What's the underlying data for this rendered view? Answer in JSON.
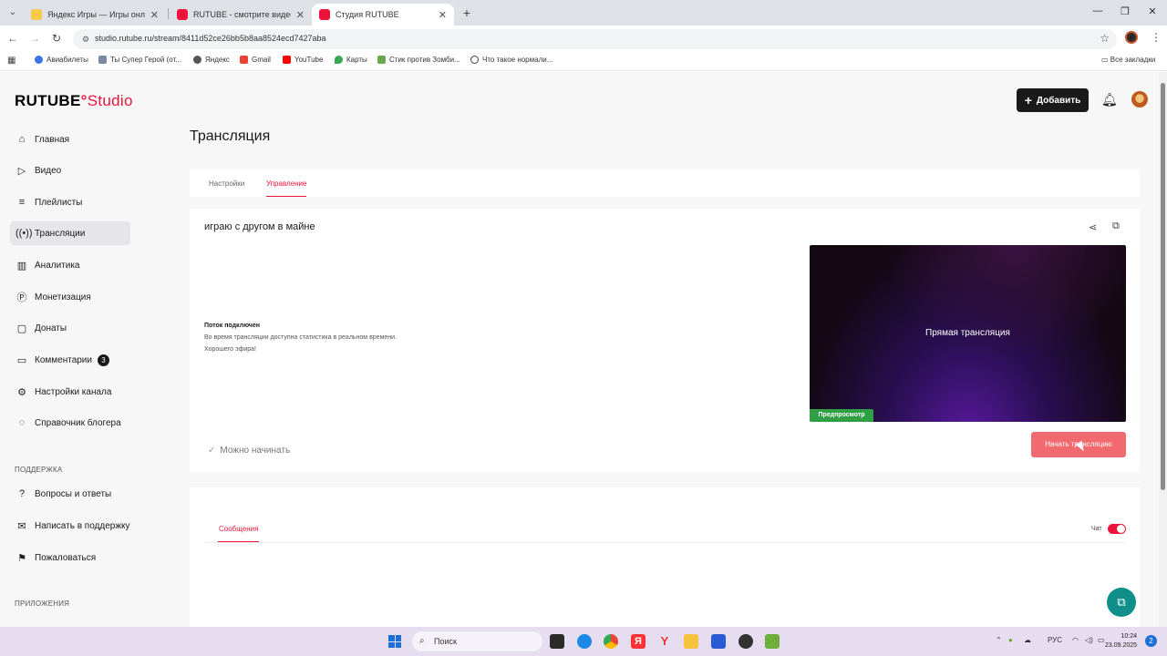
{
  "browser": {
    "tabs": [
      {
        "title": "Яндекс Игры — Игры онлайн",
        "fav_color": "#f7c948"
      },
      {
        "title": "RUTUBE - смотрите видео онлайн",
        "fav_color": "#ed143b"
      },
      {
        "title": "Студия RUTUBE",
        "fav_color": "#ed143b"
      }
    ],
    "url": "studio.rutube.ru/stream/8411d52ce26bb5b8aa8524ecd7427aba",
    "bookmarks": [
      "Авиабилеты",
      "Ты Супер Герой (от...",
      "Яндекс",
      "Gmail",
      "YouTube",
      "Карты",
      "Стик против Зомби...",
      "Что такое нормали..."
    ],
    "bookmarks_all": "Все закладки"
  },
  "header": {
    "logo_main": "RUTUBE",
    "logo_studio": "Studio",
    "add_button": "Добавить"
  },
  "sidebar": {
    "items": [
      {
        "label": "Главная",
        "icon": "home-icon"
      },
      {
        "label": "Видео",
        "icon": "video-icon"
      },
      {
        "label": "Плейлисты",
        "icon": "playlist-icon"
      },
      {
        "label": "Трансляции",
        "icon": "broadcast-icon"
      },
      {
        "label": "Аналитика",
        "icon": "analytics-icon"
      },
      {
        "label": "Монетизация",
        "icon": "monetization-icon"
      },
      {
        "label": "Донаты",
        "icon": "donations-icon"
      },
      {
        "label": "Комментарии",
        "icon": "comments-icon",
        "badge": "3"
      },
      {
        "label": "Настройки канала",
        "icon": "settings-icon"
      },
      {
        "label": "Справочник блогера",
        "icon": "handbook-icon"
      }
    ],
    "support_label": "ПОДДЕРЖКА",
    "support_items": [
      {
        "label": "Вопросы и ответы",
        "icon": "faq-icon"
      },
      {
        "label": "Написать в поддержку",
        "icon": "mail-icon"
      },
      {
        "label": "Пожаловаться",
        "icon": "flag-icon"
      }
    ],
    "apps_label": "ПРИЛОЖЕНИЯ"
  },
  "main": {
    "title": "Трансляция",
    "tabs": [
      "Настройки",
      "Управление"
    ],
    "stream": {
      "name": "играю с другом в майне",
      "status_title": "Поток подключен",
      "status_line1": "Во время трансляции доступна статистика в реальном времени.",
      "status_line2": "Хорошего эфира!",
      "preview_text": "Прямая трансляция",
      "preview_badge": "Предпросмотр",
      "can_start": "Можно начинать",
      "start_button": "Начать трансляцию"
    },
    "chat": {
      "tab": "Сообщения",
      "toggle_label": "Чат",
      "toggle_on": true
    }
  },
  "taskbar": {
    "search": "Поиск",
    "lang": "РУС",
    "time": "10:24",
    "date": "23.09.2025",
    "notifications": "2"
  }
}
